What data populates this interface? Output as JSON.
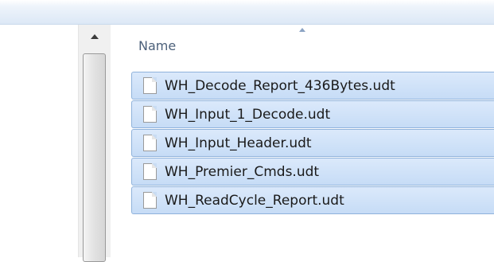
{
  "header": {
    "column_name": "Name"
  },
  "files": [
    {
      "name": "WH_Decode_Report_436Bytes.udt",
      "icon": "file-icon"
    },
    {
      "name": "WH_Input_1_Decode.udt",
      "icon": "file-icon"
    },
    {
      "name": "WH_Input_Header.udt",
      "icon": "file-icon"
    },
    {
      "name": "WH_Premier_Cmds.udt",
      "icon": "file-icon"
    },
    {
      "name": "WH_ReadCycle_Report.udt",
      "icon": "file-icon"
    }
  ],
  "colors": {
    "selection": "#cfe2f8",
    "selection_border": "#8fb2db",
    "header_text": "#4c607a"
  }
}
